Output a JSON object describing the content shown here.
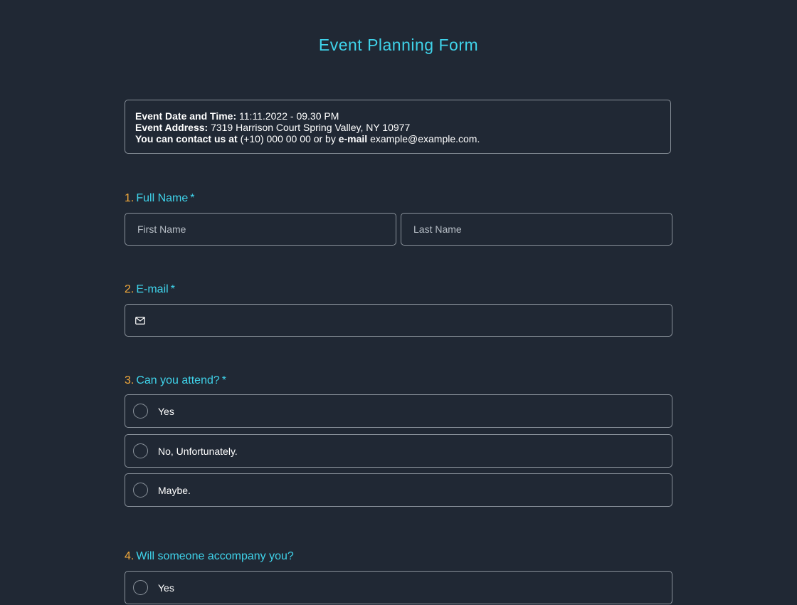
{
  "title": "Event Planning Form",
  "info": {
    "date_label": "Event Date and Time:",
    "date_value": "11:11.2022 - 09.30 PM",
    "address_label": "Event Address:",
    "address_value": "7319 Harrison Court Spring Valley, NY 10977",
    "contact_label": "You can contact us at",
    "contact_phone": "(+10) 000 00 00 or by",
    "contact_email_label": "e-mail",
    "contact_email": "example@example.com."
  },
  "questions": [
    {
      "number": "1.",
      "label": "Full Name",
      "required": "*",
      "fields": [
        {
          "placeholder": "First Name",
          "value": ""
        },
        {
          "placeholder": "Last Name",
          "value": ""
        }
      ]
    },
    {
      "number": "2.",
      "label": "E-mail",
      "required": "*",
      "icon": "envelope-icon",
      "value": ""
    },
    {
      "number": "3.",
      "label": "Can you attend?",
      "required": "*",
      "options": [
        "Yes",
        "No, Unfortunately.",
        "Maybe."
      ]
    },
    {
      "number": "4.",
      "label": "Will someone accompany you?",
      "required": "",
      "options": [
        "Yes"
      ]
    }
  ]
}
